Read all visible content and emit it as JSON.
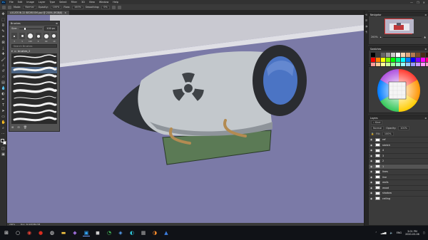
{
  "app": {
    "logo": "Ps"
  },
  "menu": [
    "File",
    "Edit",
    "Image",
    "Layer",
    "Type",
    "Select",
    "Filter",
    "3D",
    "View",
    "Window",
    "Help"
  ],
  "window_controls": [
    "—",
    "❐",
    "✕"
  ],
  "options_bar": {
    "items": [
      "Mode:",
      "Normal",
      "Opacity:",
      "100%",
      "Flow:",
      "100%",
      "Smoothing:",
      "0%"
    ]
  },
  "document_tab": {
    "title": "LOCATION 22 BEDROOM.psd @ 200% (RGB/8)",
    "close": "×"
  },
  "brushes_panel": {
    "title": "Brushes",
    "size_label": "Size:",
    "size_value": "100 px",
    "tip_labels": [
      "3",
      "5",
      "100",
      "9",
      "60",
      "10"
    ],
    "search_placeholder": "Search Brushes",
    "group_name": "brushes_2",
    "footer_icons": [
      "⊞",
      "⊟",
      "🗑"
    ]
  },
  "navigator": {
    "title": "Navigator",
    "zoom": "200%"
  },
  "swatches": {
    "title": "Swatches",
    "colors": [
      "#000000",
      "#3a3a3a",
      "#666666",
      "#999999",
      "#cccccc",
      "#ffffff",
      "#f4d3b0",
      "#e3a980",
      "#b57a51",
      "#7d4b2a",
      "#4a2a16",
      "#2a170b",
      "#ff0000",
      "#ff7f00",
      "#ffff00",
      "#7fff00",
      "#00ff00",
      "#00ff7f",
      "#00ffff",
      "#007fff",
      "#0000ff",
      "#7f00ff",
      "#ff00ff",
      "#ff007f",
      "#ff9a9a",
      "#ffcc99",
      "#ffff99",
      "#ccff99",
      "#99ff99",
      "#99ffcc",
      "#99ffff",
      "#99ccff",
      "#9999ff",
      "#cc99ff",
      "#ff99ff",
      "#ff99cc"
    ]
  },
  "layers": {
    "title": "Layers",
    "blend_mode": "Normal",
    "opacity_label": "Opacity:",
    "opacity": "100%",
    "fill_label": "Fill:",
    "fill": "100%",
    "items": [
      {
        "name": "ref",
        "active": false
      },
      {
        "name": "sketch",
        "active": false
      },
      {
        "name": "4",
        "active": false
      },
      {
        "name": "3",
        "active": false
      },
      {
        "name": "2",
        "active": false
      },
      {
        "name": "1",
        "active": true
      },
      {
        "name": "lines",
        "active": false
      },
      {
        "name": "line",
        "active": false
      },
      {
        "name": "walls",
        "active": false
      },
      {
        "name": "wood",
        "active": false
      },
      {
        "name": "shadow",
        "active": false
      },
      {
        "name": "ceiling",
        "active": false
      }
    ]
  },
  "status_bar": {
    "zoom": "200%",
    "doc": "Doc: 32.2M/384.5M"
  },
  "taskbar": {
    "language": "ENG",
    "time": "3:01 PM",
    "date": "2020-03-06"
  },
  "colors": {
    "canvas_bg": "#7b7aa7",
    "bomb_body": "#c3c8cc",
    "bomb_nose": "#2e3237",
    "bomb_tail": "#2a2c30",
    "window_glass": "#4b74c4",
    "symbol": "#3f4347",
    "pad": "#5b7a55"
  }
}
